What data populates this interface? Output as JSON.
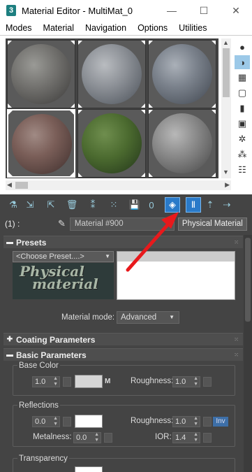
{
  "window": {
    "app_icon": "3",
    "title": "Material Editor - MultiMat_0",
    "minimize": "—",
    "maximize": "☐",
    "close": "✕"
  },
  "menu": [
    "Modes",
    "Material",
    "Navigation",
    "Options",
    "Utilities"
  ],
  "slot_row": {
    "index_label": "(1) :",
    "material_name": "Material #900",
    "material_type": "Physical Material"
  },
  "presets": {
    "header": "Presets",
    "dropdown": "<Choose Preset....>",
    "image_text_line1": "Physical",
    "image_text_line2": "material",
    "material_mode_label": "Material mode:",
    "material_mode_value": "Advanced"
  },
  "coating": {
    "header": "Coating Parameters"
  },
  "basic": {
    "header": "Basic Parameters",
    "base_color": {
      "group_label": "Base Color",
      "weight": "1.0",
      "swatch_color": "#d6d6d6",
      "m_label": "M",
      "roughness_label": "Roughness:",
      "roughness": "1.0"
    },
    "reflections": {
      "group_label": "Reflections",
      "weight": "0.0",
      "swatch_color": "#ffffff",
      "roughness_label": "Roughness:",
      "roughness": "1.0",
      "inv_label": "Inv",
      "metalness_label": "Metalness:",
      "metalness": "0.0",
      "ior_label": "IOR:",
      "ior": "1.4"
    },
    "transparency": {
      "group_label": "Transparency"
    }
  },
  "icons": [
    "sphere-icon",
    "eyedropper-icon",
    "delete-icon",
    "pick-icon",
    "show-map-icon",
    "annotation-arrow"
  ],
  "colors": {
    "panel": "#444444",
    "highlight": "#2a7ac9",
    "annotation_arrow": "#e8191c"
  }
}
